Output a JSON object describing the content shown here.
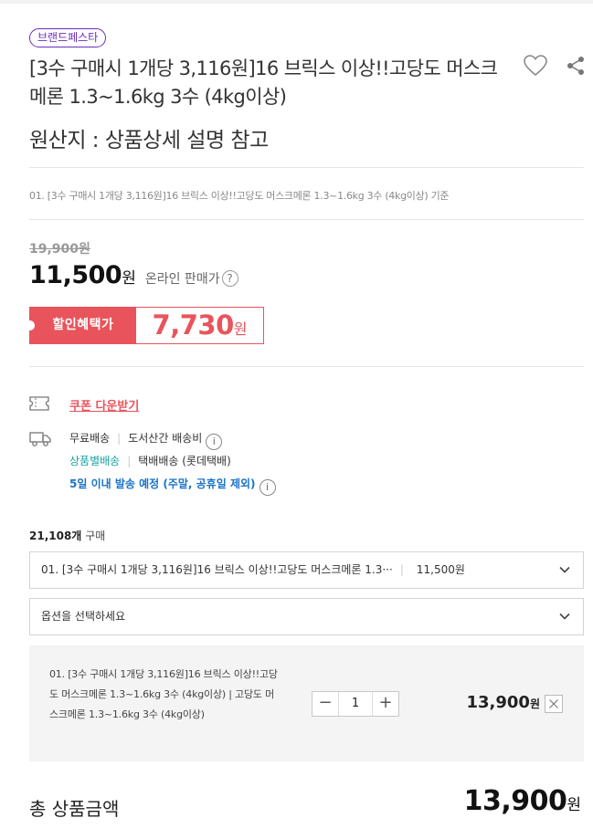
{
  "brand_badge": "브랜드페스타",
  "product": {
    "title": "[3수 구매시 1개당 3,116원]16 브릭스 이상!!고당도 머스크메론 1.3~1.6kg 3수 (4kg이상)",
    "origin": "원산지 : 상품상세 설명 참고",
    "price_criterion": "01. [3수 구매시 1개당 3,116원]16 브릭스 이상!!고당도 머스크메론 1.3~1.6kg 3수 (4kg이상) 기준"
  },
  "price": {
    "original": "19,900",
    "original_unit": "원",
    "online": "11,500",
    "online_unit": "원",
    "online_label": "온라인 판매가",
    "help_glyph": "?",
    "discount_label": "할인혜택가",
    "discount": "7,730",
    "discount_unit": "원"
  },
  "benefits": {
    "coupon_link": "쿠폰 다운받기",
    "shipping_free": "무료배송",
    "shipping_island": "도서산간 배송비",
    "shipping_by_product": "상품별배송",
    "shipping_courier": "택배배송 (롯데택배)",
    "dispatch_note": "5일 이내 발송 예정 (주말, 공휴일 제외)",
    "info_glyph": "i"
  },
  "purchase": {
    "count": "21,108개",
    "count_suffix": "구매"
  },
  "selects": {
    "product_value": "01. [3수 구매시 1개당 3,116원]16 브릭스 이상!!고당도 머스크메론 1.3···",
    "product_price": "11,500원",
    "option_placeholder": "옵션을 선택하세요"
  },
  "selected_option": {
    "name": "01. [3수 구매시 1개당 3,116원]16 브릭스 이상!!고당도 머스크메론 1.3~1.6kg 3수 (4kg이상) | 고당도 머스크메론 1.3~1.6kg 3수 (4kg이상)",
    "quantity": "1",
    "minus": "−",
    "plus": "+",
    "price": "13,900",
    "price_unit": "원"
  },
  "total": {
    "label": "총 상품금액",
    "amount": "13,900",
    "unit": "원"
  },
  "colors": {
    "accent_red": "#e9545c",
    "badge_purple": "#6a2cbf",
    "teal": "#1aa3a3",
    "blue": "#1a73c9"
  },
  "icons": [
    "heart-icon",
    "share-icon",
    "coupon-icon",
    "truck-icon",
    "chevron-down-icon",
    "close-icon"
  ]
}
